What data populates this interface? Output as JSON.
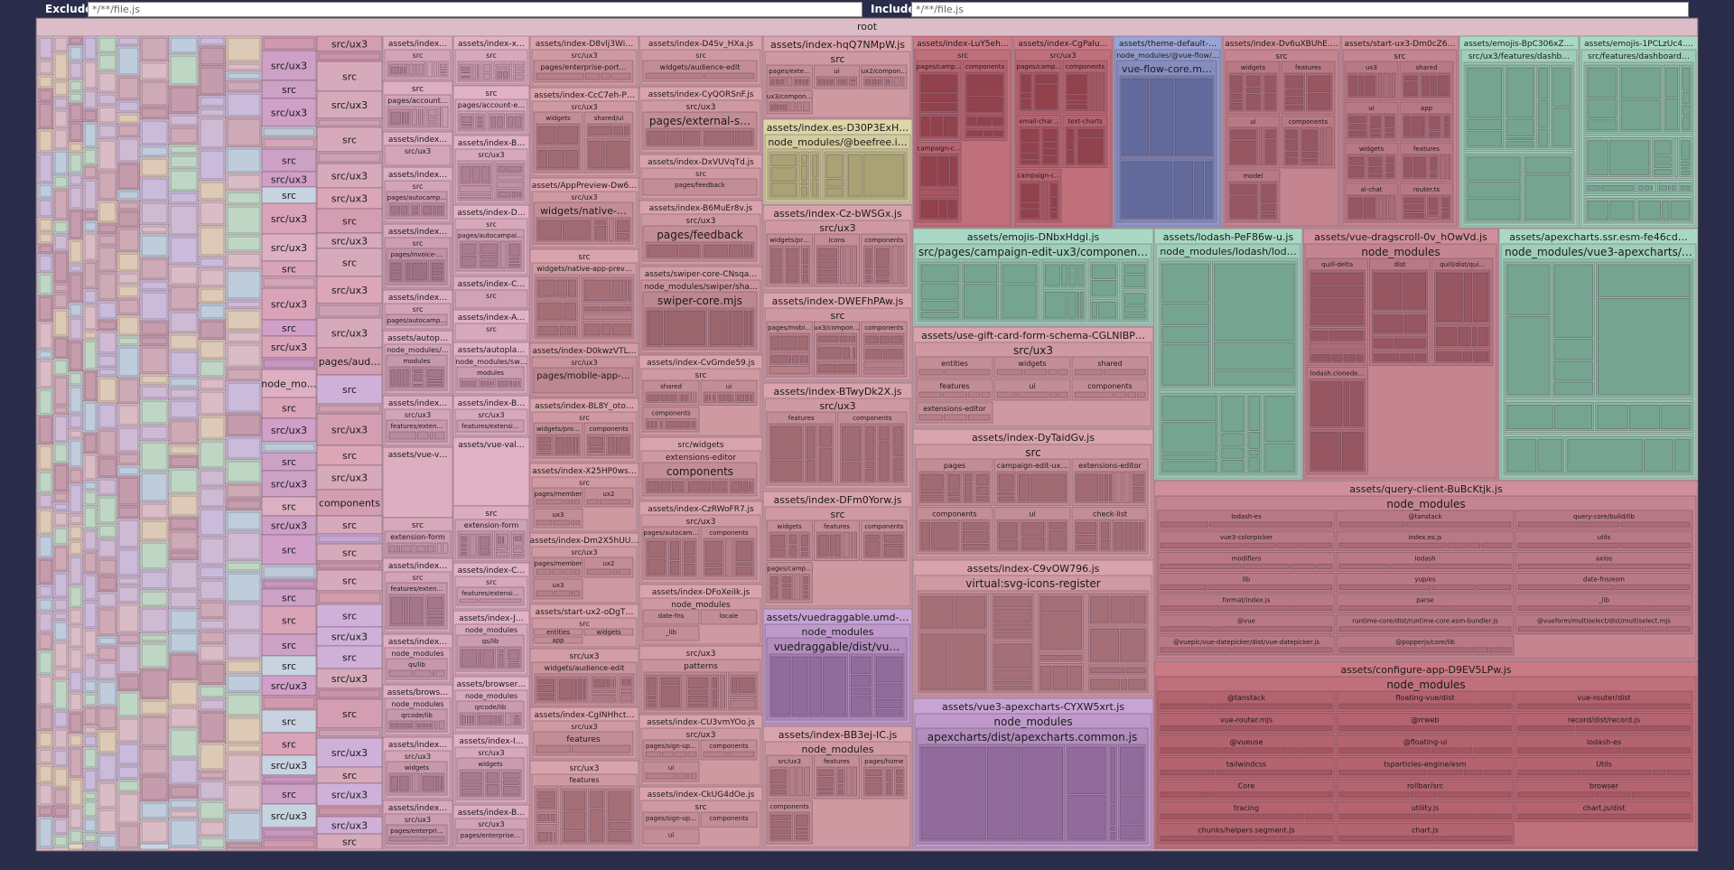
{
  "filters": {
    "exclude_label": "Exclude",
    "exclude_value": "*/**/file.js",
    "include_label": "Include",
    "include_value": "*/**/file.js"
  },
  "root_label": "root",
  "colors": {
    "background": "#2a2d4a",
    "pink": "#d9a3ac",
    "pink_mid": "#cf8f9a",
    "rose_deep": "#c97a85",
    "mint": "#a9d9c4",
    "lavender": "#c8a3d4",
    "blue": "#9aa3d4",
    "khaki": "#dcd6a8"
  },
  "tiles": [
    {
      "name": "index-hqQ7NMpW",
      "label": "assets/index-hqQ7NMpW.js",
      "sub": [
        "src",
        "pages/external-subscription-edit",
        "ui",
        "ux2/components",
        "ux3/components"
      ],
      "color": "pink"
    },
    {
      "name": "index-LuY5ehEM",
      "label": "assets/index-LuY5ehEM.js",
      "sub": [
        "src",
        "pages/campaign-details-ux3",
        "components",
        "campaign-charts"
      ],
      "color": "rose_deep"
    },
    {
      "name": "index-CgPalu3n",
      "label": "assets/index-CgPalu3n.js",
      "sub": [
        "src/ux3",
        "pages/campaign-details-ux3",
        "components",
        "email-charts",
        "text-charts",
        "campaign-charts"
      ],
      "color": "rose_deep"
    },
    {
      "name": "theme-default",
      "label": "assets/theme-default-BMr6uGWK.js",
      "sub": [
        "node_modules/@vue-flow/core/dist",
        "vue-flow-core.mjs"
      ],
      "color": "blue"
    },
    {
      "name": "index-misc-right",
      "label": "assets/index-Dv6uXBUhE.js",
      "sub": [
        "src",
        "widgets",
        "features",
        "ui",
        "components",
        "model"
      ],
      "color": "pink_mid"
    },
    {
      "name": "start-ux3",
      "label": "assets/start-ux3-Dm0cZ63j.js",
      "sub": [
        "src",
        "ux3",
        "shared",
        "ui",
        "app",
        "widgets",
        "features",
        "ai-chat",
        "router.ts"
      ],
      "color": "pink_mid"
    },
    {
      "name": "emojis-BpC306xZ",
      "label": "assets/emojis-BpC306xZ.js",
      "sub": [
        "src/ux3/features/dashboard-content-editor/data/emojis.json"
      ],
      "color": "mint"
    },
    {
      "name": "emojis-1PCLzUc4",
      "label": "assets/emojis-1PCLzUc4.js",
      "sub": [
        "src/features/dashboard-content-editor/data/emojis.json"
      ],
      "color": "mint"
    },
    {
      "name": "index-D30P3ExH",
      "label": "assets/index.es-D30P3ExH.js",
      "sub": [
        "node_modules/@beefree.io/sdk/dist/index.es.js"
      ],
      "color": "khaki"
    },
    {
      "name": "index-Cz-bWSGx",
      "label": "assets/index-Cz-bWSGx.js",
      "sub": [
        "src/ux3",
        "widgets/program-settings",
        "icons",
        "components"
      ],
      "color": "pink"
    },
    {
      "name": "index-DWEFhPAw",
      "label": "assets/index-DWEFhPAw.js",
      "sub": [
        "src",
        "pages/mobile-app-setting",
        "ux3/components",
        "components"
      ],
      "color": "pink"
    },
    {
      "name": "index-BTwyDk2X",
      "label": "assets/index-BTwyDk2X.js",
      "sub": [
        "src/ux3",
        "features",
        "components"
      ],
      "color": "pink"
    },
    {
      "name": "index-DFm0Yorw",
      "label": "assets/index-DFm0Yorw.js",
      "sub": [
        "src",
        "widgets",
        "features",
        "components",
        "pages/campaign-edit"
      ],
      "color": "pink"
    },
    {
      "name": "vuedraggable",
      "label": "assets/vuedraggable.umd-BzYjX69u.js",
      "sub": [
        "node_modules",
        "vuedraggable/dist/vuedraggable.umd.js"
      ],
      "color": "lavender"
    },
    {
      "name": "index-BB3ej-IC",
      "label": "assets/index-BB3ej-IC.js",
      "sub": [
        "node_modules",
        "src/ux3",
        "features",
        "pages/home",
        "components"
      ],
      "color": "pink"
    },
    {
      "name": "emojis-DNbxHdgI",
      "label": "assets/emojis-DNbxHdgl.js",
      "sub": [
        "src/pages/campaign-edit-ux3/components/dashboard-editor/components/dashboard-content-editor/data/emojis.json"
      ],
      "color": "mint"
    },
    {
      "name": "gift-card-schema",
      "label": "assets/use-gift-card-form-schema-CGLNIBPT.js",
      "sub": [
        "src/ux3",
        "entities",
        "widgets",
        "shared",
        "features",
        "ui",
        "components",
        "extensions-editor"
      ],
      "color": "pink"
    },
    {
      "name": "index-DyTaidGv",
      "label": "assets/index-DyTaidGv.js",
      "sub": [
        "src",
        "pages",
        "campaign-edit-ux3/components",
        "extensions-editor",
        "components",
        "ui",
        "check-list"
      ],
      "color": "pink"
    },
    {
      "name": "index-C9vOW796",
      "label": "assets/index-C9vOW796.js",
      "sub": [
        "virtual:svg-icons-register"
      ],
      "color": "pink"
    },
    {
      "name": "vue3-apexcharts",
      "label": "assets/vue3-apexcharts-CYXW5xrt.js",
      "sub": [
        "node_modules",
        "apexcharts/dist/apexcharts.common.js"
      ],
      "color": "lavender"
    },
    {
      "name": "lodash",
      "label": "assets/lodash-PeF86w-u.js",
      "sub": [
        "node_modules/lodash/lodash.js"
      ],
      "color": "mint"
    },
    {
      "name": "vue-dragscroll",
      "label": "assets/vue-dragscroll-0v_hOwVd.js",
      "sub": [
        "node_modules",
        "quill-delta",
        "dist",
        "quill/dist/quill.js",
        "lodash.clonedeep/index.js"
      ],
      "color": "pink_mid"
    },
    {
      "name": "apexcharts-ssr",
      "label": "assets/apexcharts.ssr.esm-fe46cd2d-CJ7-Qyel.js",
      "sub": [
        "node_modules/vue3-apexcharts/dist/apexcharts.ssr.esm-fe46cd2d.js"
      ],
      "color": "mint"
    },
    {
      "name": "query-client",
      "label": "assets/query-client-BuBcKtjk.js",
      "sub": [
        "node_modules",
        "lodash-es",
        "@tanstack",
        "query-core/build/lib",
        "vue3-colorpicker",
        "index.es.js",
        "utils",
        "modifiers",
        "lodash",
        "axios",
        "lib",
        "yup/es",
        "date-fns/esm",
        "format/index.js",
        "parse",
        "_lib",
        "@vue",
        "runtime-core/dist/runtime-core.esm-bundler.js",
        "@vueform/multiselect/dist/multiselect.mjs",
        "@vuepic/vue-datepicker/dist/vue-datepicker.js",
        "@popperjs/core/lib"
      ],
      "color": "pink_mid"
    },
    {
      "name": "configure-app",
      "label": "assets/configure-app-D9EV5LPw.js",
      "sub": [
        "node_modules",
        "@tanstack",
        "floating-vue/dist",
        "vue-router/dist",
        "vue-router.mjs",
        "@rrweb",
        "record/dist/record.js",
        "@vueuse",
        "@floating-ui",
        "lodash-es",
        "tailwindcss",
        "tsparticles-engine/esm",
        "Utils",
        "Core",
        "rollbar/src",
        "browser",
        "tracing",
        "utility.js",
        "chart.js/dist",
        "chunks/helpers.segment.js",
        "chart.js"
      ],
      "color": "rose_deep"
    }
  ],
  "col1": [
    {
      "name": "index-D8vlj3Wi",
      "label": "assets/index-D8vlj3Wi.js",
      "sub": [
        "src/ux3",
        "pages/enterprise-portal"
      ]
    },
    {
      "name": "index-CcC7eh-P",
      "label": "assets/index-CcC7eh-P.js",
      "sub": [
        "src/ux3",
        "widgets",
        "shared/ui"
      ]
    },
    {
      "name": "AppPreview",
      "label": "assets/AppPreview-Dw6xRJ3d.js",
      "sub": [
        "src/ux3",
        "widgets/native-app-preview"
      ]
    },
    {
      "name": "blank1",
      "label": "src",
      "sub": [
        "widgets/native-app-preview"
      ]
    },
    {
      "name": "index-D0kwzVTL",
      "label": "assets/index-D0kwzVTL.js",
      "sub": [
        "src/ux3",
        "pages/mobile-app-setting"
      ]
    },
    {
      "name": "index-BL8Y_oto",
      "label": "assets/index-BL8Y_oto.js",
      "sub": [
        "src",
        "widgets/program-settings",
        "components"
      ]
    },
    {
      "name": "index-X25HP0ws",
      "label": "assets/index-X25HP0ws.js",
      "sub": [
        "src",
        "pages/member",
        "ux2",
        "ux3"
      ]
    },
    {
      "name": "index-Dm2X5hUU",
      "label": "assets/index-Dm2X5hUU.js",
      "sub": [
        "src/ux3",
        "pages/member",
        "ux2",
        "ux3"
      ]
    },
    {
      "name": "start-ux2",
      "label": "assets/start-ux2-oDgT4UXV.js",
      "sub": [
        "src",
        "entities",
        "widgets",
        "app"
      ]
    },
    {
      "name": "blank2",
      "label": "src/ux3",
      "sub": [
        "widgets/audience-edit"
      ]
    },
    {
      "name": "index-CgINHhct",
      "label": "assets/index-CgINHhct.js",
      "sub": [
        "src/ux3",
        "features"
      ]
    },
    {
      "name": "blank3",
      "label": "src/ux3",
      "sub": [
        "features"
      ]
    }
  ],
  "col2": [
    {
      "name": "index-D4Sv_HXa",
      "label": "assets/index-D4Sv_HXa.js",
      "sub": [
        "src",
        "widgets/audience-edit"
      ]
    },
    {
      "name": "index-CyQORSnF",
      "label": "assets/index-CyQORSnF.js",
      "sub": [
        "src/ux3",
        "pages/external-subscription-edit"
      ]
    },
    {
      "name": "index-DxVUVqTd",
      "label": "assets/index-DxVUVqTd.js",
      "sub": [
        "src",
        "pages/feedback"
      ]
    },
    {
      "name": "index-B6MuEr8v",
      "label": "assets/index-B6MuEr8v.js",
      "sub": [
        "src/ux3",
        "pages/feedback"
      ]
    },
    {
      "name": "swiper-core",
      "label": "assets/swiper-core-CNsqaBy.js",
      "sub": [
        "node_modules/swiper/shared",
        "swiper-core.mjs"
      ]
    },
    {
      "name": "index-CvGmde59",
      "label": "assets/index-CvGmde59.js",
      "sub": [
        "src",
        "shared",
        "ui",
        "components"
      ]
    },
    {
      "name": "blank4",
      "label": "src/widgets",
      "sub": [
        "extensions-editor",
        "components"
      ]
    },
    {
      "name": "index-CzRWoFR7",
      "label": "assets/index-CzRWoFR7.js",
      "sub": [
        "src/ux3",
        "pages/autocampaign",
        "components"
      ]
    },
    {
      "name": "index-DFoXeiIk",
      "label": "assets/index-DFoXeiIk.js",
      "sub": [
        "node_modules",
        "date-fns",
        "locale",
        "_lib"
      ]
    },
    {
      "name": "blank5",
      "label": "src/ux3",
      "sub": [
        "patterns"
      ]
    },
    {
      "name": "index-CU3vmYOo",
      "label": "assets/index-CU3vmYOo.js",
      "sub": [
        "src/ux3",
        "pages/sign-up-form",
        "components",
        "ui"
      ]
    },
    {
      "name": "index-CkUG4dOe",
      "label": "assets/index-CkUG4dOe.js",
      "sub": [
        "src",
        "pages/sign-up-form",
        "components",
        "ui"
      ]
    }
  ],
  "col0": [
    {
      "name": "index-x5gQ3u8T",
      "label": "assets/index-x5gQ3u8T.js",
      "sub": [
        "src"
      ]
    },
    {
      "name": "blank6",
      "label": "src",
      "sub": [
        "pages/account-edit"
      ]
    },
    {
      "name": "index-BVzPr2UF",
      "label": "assets/index-BVzPr2UF.js",
      "sub": [
        "src/ux3"
      ]
    },
    {
      "name": "index-DOqwtLNo",
      "label": "assets/index-DOqwtLNo.js",
      "sub": [
        "src",
        "pages/autocampaigns"
      ]
    },
    {
      "name": "index-COYHYI5t",
      "label": "assets/index-COYHYI5t.js",
      "sub": [
        "src",
        "pages/invoice-new"
      ]
    },
    {
      "name": "index-AWdLzrXG",
      "label": "assets/index-AWdLzrXG.js",
      "sub": [
        "src",
        "pages/autocampaign-edit"
      ]
    },
    {
      "name": "autoplay",
      "label": "assets/autoplay-Cl7uGKWh.js",
      "sub": [
        "node_modules/swiper",
        "modules"
      ]
    },
    {
      "name": "index-BpohQjYC",
      "label": "assets/index-BpohQjYC.js",
      "sub": [
        "src/ux3",
        "features/extension-form"
      ]
    },
    {
      "name": "blank7",
      "label": "assets/vue-validate",
      "sub": []
    },
    {
      "name": "blank8",
      "label": "src",
      "sub": [
        "extension-form"
      ]
    },
    {
      "name": "index-C4wDOf8I",
      "label": "assets/index-C4wDOf8I.js",
      "sub": [
        "src",
        "features/extension-form"
      ]
    },
    {
      "name": "index-JDmizVue",
      "label": "assets/index-JDmizVue.js",
      "sub": [
        "node_modules",
        "qs/lib"
      ]
    },
    {
      "name": "browser",
      "label": "assets/browser-DrQvcJH.js",
      "sub": [
        "node_modules",
        "qrcode/lib"
      ]
    },
    {
      "name": "index-I6u06W1M",
      "label": "assets/index-I6u06W1M.js",
      "sub": [
        "src/ux3",
        "widgets"
      ]
    },
    {
      "name": "index-BUTkeFw4",
      "label": "assets/index-BUTkeFw4.js",
      "sub": [
        "src/ux3",
        "pages/enterprise-billing"
      ]
    }
  ],
  "col_small_labels": [
    "src/ux3",
    "src",
    "src/ux3",
    "src",
    "src/ux3",
    "src",
    "src/ux3",
    "src/ux3",
    "src",
    "src/ux3",
    "src",
    "src/ux3",
    "node_modules",
    "src",
    "src/ux3",
    "src",
    "src/ux3",
    "src",
    "src/ux3",
    "src",
    "src",
    "src",
    "src",
    "src",
    "src/ux3",
    "src",
    "src",
    "src/ux3",
    "src"
  ],
  "col_small2_labels": [
    "src/ux3",
    "src",
    "src/ux3",
    "src",
    "src/ux3",
    "src/ux3",
    "src",
    "src/ux3",
    "src",
    "src/ux3",
    "src/ux3",
    "pages/audience",
    "src",
    "src/ux3",
    "src",
    "src/ux3",
    "components",
    "src",
    "src",
    "src",
    "src",
    "src/ux3",
    "src"
  ]
}
